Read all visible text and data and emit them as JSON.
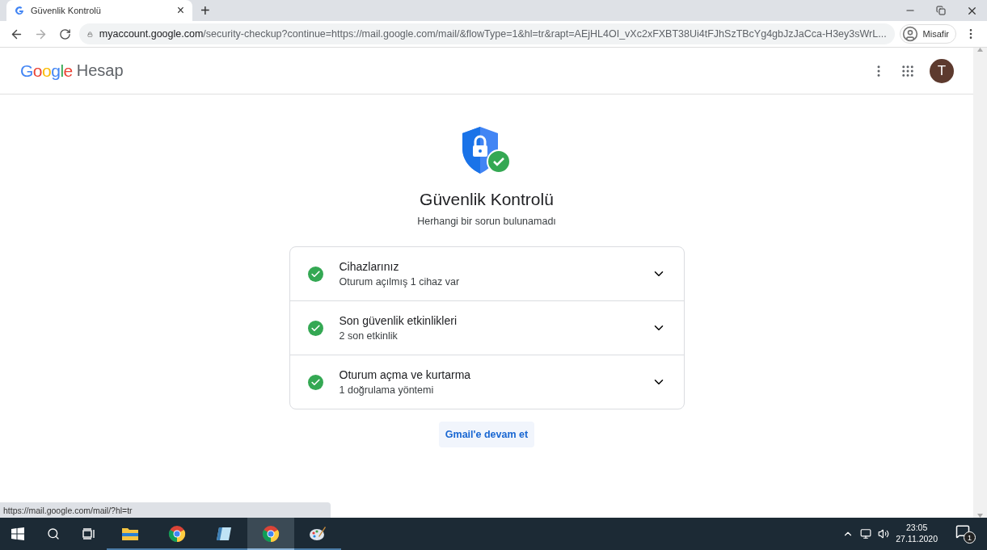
{
  "browser": {
    "tab": {
      "title": "Güvenlik Kontrolü",
      "close": "×",
      "selected": true
    },
    "new_tab": "+",
    "address": {
      "host": "myaccount.google.com",
      "path": "/security-checkup?continue=https://mail.google.com/mail/&flowType=1&hl=tr&rapt=AEjHL4OI_vXc2xFXBT38Ui4tFJhSzTBcYg4gbJzJaCca-H3ey3sWrL..."
    },
    "profile": "Misafir",
    "status_url": "https://mail.google.com/mail/?hl=tr"
  },
  "header": {
    "logo": "Google",
    "product": "Hesap",
    "avatar": "T"
  },
  "checkup": {
    "title": "Güvenlik Kontrolü",
    "subtitle": "Herhangi bir sorun bulunamadı",
    "items": [
      {
        "title": "Cihazlarınız",
        "detail": "Oturum açılmış 1 cihaz var",
        "ok": true,
        "expanded": false
      },
      {
        "title": "Son güvenlik etkinlikleri",
        "detail": "2 son etkinlik",
        "ok": true,
        "expanded": false
      },
      {
        "title": "Oturum açma ve kurtarma",
        "detail": "1 doğrulama yöntemi",
        "ok": true,
        "expanded": false
      }
    ],
    "continue_button": "Gmail'e devam et"
  },
  "taskbar": {
    "apps": [
      {
        "kind": "folder",
        "active": false
      },
      {
        "kind": "chrome",
        "active": false
      },
      {
        "kind": "notepad",
        "active": false
      },
      {
        "kind": "chrome",
        "active": true
      },
      {
        "kind": "paint",
        "active": false
      }
    ],
    "time": "23:05",
    "date": "27.11.2020",
    "notifications": "1"
  }
}
